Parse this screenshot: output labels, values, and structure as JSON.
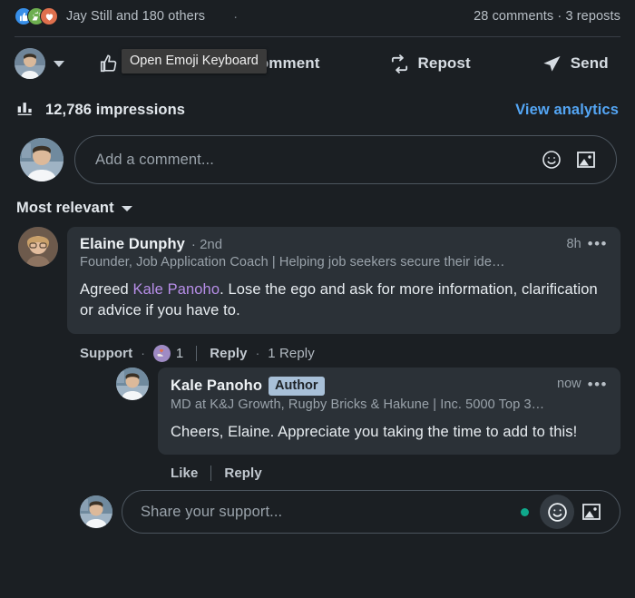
{
  "social": {
    "reactions": [
      {
        "name": "like-reaction-icon",
        "glyph": "👍"
      },
      {
        "name": "celebrate-reaction-icon",
        "glyph": "👏"
      },
      {
        "name": "love-reaction-icon",
        "glyph": "❤"
      }
    ],
    "reactors_text": "Jay Still and 180 others",
    "separator": "·",
    "stats_text": "28 comments · 3 reposts"
  },
  "action_bar": {
    "tooltip": "Open Emoji Keyboard",
    "like_label": "Like",
    "comment_label": "Comment",
    "repost_label": "Repost",
    "send_label": "Send"
  },
  "impressions": {
    "count_text": "12,786 impressions",
    "analytics_link": "View analytics"
  },
  "composer": {
    "placeholder": "Add a comment..."
  },
  "sort": {
    "label": "Most relevant"
  },
  "comments": [
    {
      "name": "Elaine Dunphy",
      "degree": "· 2nd",
      "headline": "Founder, Job Application Coach | Helping job seekers secure their ide…",
      "time": "8h",
      "more": "•••",
      "text_before": "Agreed ",
      "mention": "Kale Panoho",
      "text_after": ". Lose the ego and ask for more information, clarification or advice if you have to.",
      "actions": {
        "react_label": "Support",
        "dot": "·",
        "reaction_glyph": "🤲",
        "reaction_count": "1",
        "reply_label": "Reply",
        "sep": "·",
        "reply_count": "1 Reply"
      }
    }
  ],
  "reply": {
    "name": "Kale Panoho",
    "badge": "Author",
    "headline": "MD at K&J Growth, Rugby Bricks & Hakune | Inc. 5000 Top 3…",
    "time": "now",
    "more": "•••",
    "text": "Cheers, Elaine. Appreciate you taking the time to add to this!",
    "actions": {
      "like_label": "Like",
      "reply_label": "Reply"
    }
  },
  "reply_composer": {
    "placeholder": "Share your support..."
  },
  "colors": {
    "page_bg": "#1b1f23",
    "bubble_bg": "#2b3137",
    "link_blue": "#54a6f5",
    "mention_purple": "#b78ee8",
    "author_badge_bg": "#a8c0d8",
    "status_dot": "#0fa88b"
  }
}
